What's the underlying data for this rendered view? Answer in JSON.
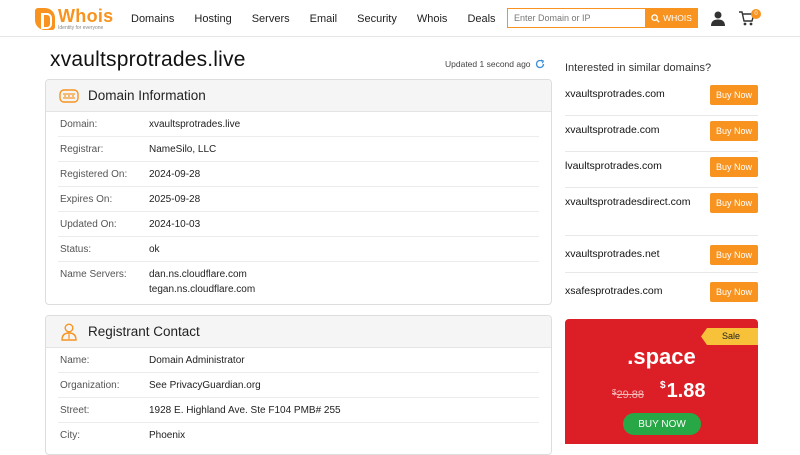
{
  "header": {
    "logo_title": "Whois",
    "logo_tagline": "Identity for everyone",
    "nav": [
      "Domains",
      "Hosting",
      "Servers",
      "Email",
      "Security",
      "Whois",
      "Deals"
    ],
    "search_placeholder": "Enter Domain or IP",
    "search_button": "WHOIS",
    "cart_count": "0"
  },
  "page": {
    "title": "xvaultsprotrades.live",
    "updated": "Updated 1 second ago"
  },
  "domain_info": {
    "title": "Domain Information",
    "rows": [
      {
        "label": "Domain:",
        "value": "xvaultsprotrades.live"
      },
      {
        "label": "Registrar:",
        "value": "NameSilo, LLC"
      },
      {
        "label": "Registered On:",
        "value": "2024-09-28"
      },
      {
        "label": "Expires On:",
        "value": "2025-09-28"
      },
      {
        "label": "Updated On:",
        "value": "2024-10-03"
      },
      {
        "label": "Status:",
        "value": "ok"
      },
      {
        "label": "Name Servers:",
        "value": "dan.ns.cloudflare.com",
        "value2": "tegan.ns.cloudflare.com"
      }
    ]
  },
  "registrant": {
    "title": "Registrant Contact",
    "rows": [
      {
        "label": "Name:",
        "value": "Domain Administrator"
      },
      {
        "label": "Organization:",
        "value": "See PrivacyGuardian.org"
      },
      {
        "label": "Street:",
        "value": "1928 E. Highland Ave. Ste F104 PMB# 255"
      },
      {
        "label": "City:",
        "value": "Phoenix"
      }
    ]
  },
  "similar": {
    "title": "Interested in similar domains?",
    "buy_label": "Buy Now",
    "domains": [
      {
        "name": "xvaultsprotrades.com"
      },
      {
        "name": "xvaultsprotrade.com"
      },
      {
        "name": "lvaultsprotrades.com"
      },
      {
        "name": "xvaultsprotradesdirect.com"
      },
      {
        "name": "xvaultsprotrades.net"
      },
      {
        "name": "xsafesprotrades.com"
      }
    ]
  },
  "promo": {
    "sale_label": "Sale",
    "tld": ".space",
    "old_price": "29.88",
    "old_currency": "$",
    "currency": "$",
    "new_price": "1.88",
    "button": "BUY NOW"
  },
  "colors": {
    "accent": "#f7931e",
    "promo_bg": "#dc1f26",
    "promo_button": "#27a745",
    "sale_tag": "#f7c23a"
  }
}
